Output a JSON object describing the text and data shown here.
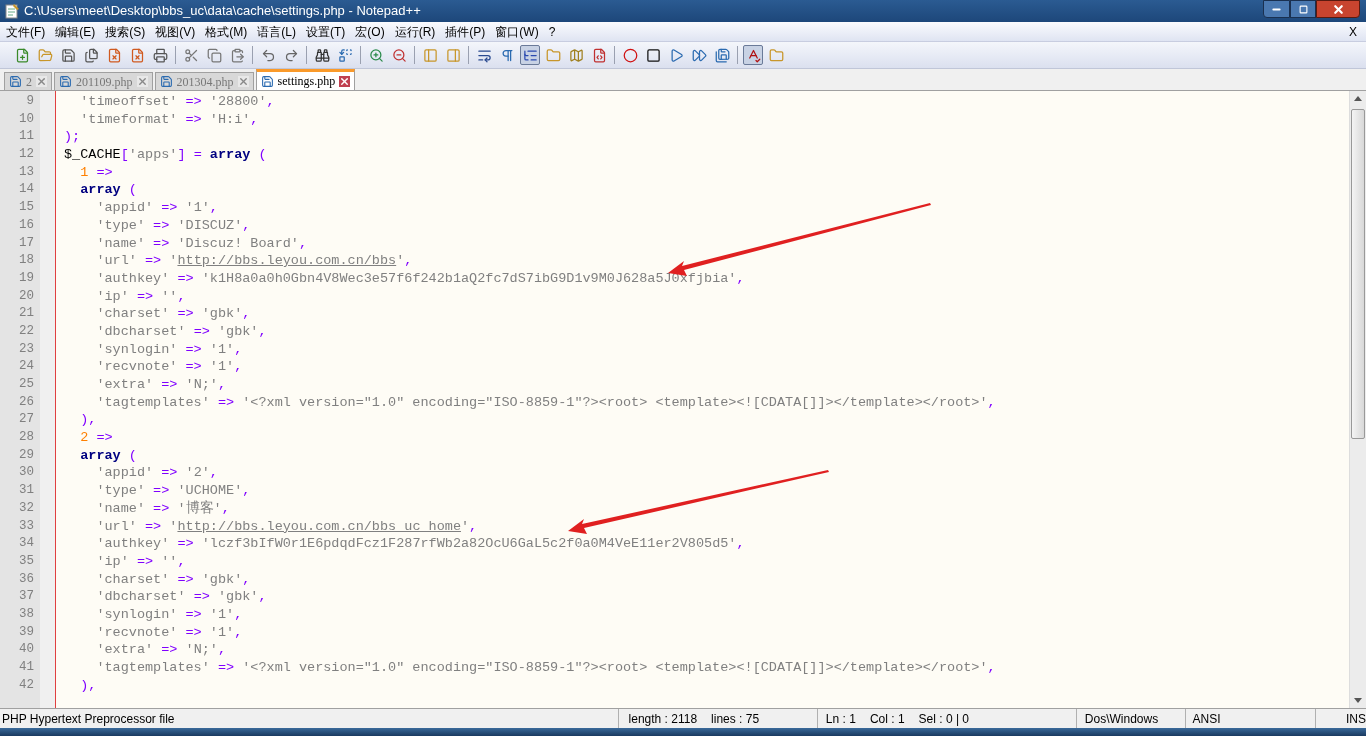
{
  "window": {
    "title": "C:\\Users\\meet\\Desktop\\bbs_uc\\data\\cache\\settings.php - Notepad++"
  },
  "menu": [
    "文件(F)",
    "编辑(E)",
    "搜索(S)",
    "视图(V)",
    "格式(M)",
    "语言(L)",
    "设置(T)",
    "宏(O)",
    "运行(R)",
    "插件(P)",
    "窗口(W)",
    "?"
  ],
  "menu_close": "X",
  "toolbar": [
    {
      "pressed": false
    },
    {
      "pressed": false
    },
    {
      "pressed": false
    },
    {
      "pressed": false
    },
    {
      "pressed": false
    },
    {
      "pressed": false
    },
    {
      "pressed": false
    },
    {
      "pressed": false
    },
    {
      "pressed": false
    },
    {
      "pressed": false
    },
    {
      "pressed": false
    },
    {
      "pressed": false
    },
    {
      "pressed": false
    },
    {
      "pressed": false
    },
    {
      "pressed": false
    },
    {
      "pressed": false
    },
    {
      "pressed": false
    },
    {
      "pressed": false
    },
    {
      "pressed": false
    },
    {
      "pressed": false
    },
    {
      "pressed": true
    },
    {
      "pressed": false
    },
    {
      "pressed": false
    },
    {
      "pressed": false
    },
    {
      "pressed": false
    },
    {
      "pressed": false
    },
    {
      "pressed": false
    },
    {
      "pressed": false
    },
    {
      "pressed": false
    },
    {
      "pressed": true
    },
    {
      "pressed": false
    }
  ],
  "tabs": [
    {
      "label": "2",
      "selected": false
    },
    {
      "label": "201109.php",
      "selected": false
    },
    {
      "label": "201304.php",
      "selected": false
    },
    {
      "label": "settings.php",
      "selected": true
    }
  ],
  "lines": [
    {
      "number": "9",
      "tokens": [
        {
          "kind": "string",
          "text": "  'timeoffset'"
        },
        {
          "kind": "operator",
          "text": " =>"
        },
        {
          "kind": "string",
          "text": " '28800'"
        },
        {
          "kind": "operator",
          "text": ","
        }
      ]
    },
    {
      "number": "10",
      "tokens": [
        {
          "kind": "string",
          "text": "  'timeformat'"
        },
        {
          "kind": "operator",
          "text": " =>"
        },
        {
          "kind": "string",
          "text": " 'H:i'"
        },
        {
          "kind": "operator",
          "text": ","
        }
      ]
    },
    {
      "number": "11",
      "tokens": [
        {
          "kind": "operator",
          "text": ");"
        }
      ]
    },
    {
      "number": "12",
      "tokens": [
        {
          "kind": "plain",
          "text": "$_CACHE"
        },
        {
          "kind": "operator",
          "text": "["
        },
        {
          "kind": "string",
          "text": "'apps'"
        },
        {
          "kind": "operator",
          "text": "] ="
        },
        {
          "kind": "keyword",
          "text": " array"
        },
        {
          "kind": "operator",
          "text": " ("
        }
      ]
    },
    {
      "number": "13",
      "tokens": [
        {
          "kind": "number",
          "text": "  1"
        },
        {
          "kind": "operator",
          "text": " =>"
        }
      ]
    },
    {
      "number": "14",
      "tokens": [
        {
          "kind": "keyword",
          "text": "  array"
        },
        {
          "kind": "operator",
          "text": " ("
        }
      ]
    },
    {
      "number": "15",
      "tokens": [
        {
          "kind": "string",
          "text": "    'appid'"
        },
        {
          "kind": "operator",
          "text": " =>"
        },
        {
          "kind": "string",
          "text": " '1'"
        },
        {
          "kind": "operator",
          "text": ","
        }
      ]
    },
    {
      "number": "16",
      "tokens": [
        {
          "kind": "string",
          "text": "    'type'"
        },
        {
          "kind": "operator",
          "text": " =>"
        },
        {
          "kind": "string",
          "text": " 'DISCUZ'"
        },
        {
          "kind": "operator",
          "text": ","
        }
      ]
    },
    {
      "number": "17",
      "tokens": [
        {
          "kind": "string",
          "text": "    'name'"
        },
        {
          "kind": "operator",
          "text": " =>"
        },
        {
          "kind": "string",
          "text": " 'Discuz! Board'"
        },
        {
          "kind": "operator",
          "text": ","
        }
      ]
    },
    {
      "number": "18",
      "tokens": [
        {
          "kind": "string",
          "text": "    'url'"
        },
        {
          "kind": "operator",
          "text": " =>"
        },
        {
          "kind": "string",
          "text": " '"
        },
        {
          "kind": "url",
          "text": "http://bbs.leyou.com.cn/bbs"
        },
        {
          "kind": "string",
          "text": "'"
        },
        {
          "kind": "operator",
          "text": ","
        }
      ]
    },
    {
      "number": "19",
      "tokens": [
        {
          "kind": "string",
          "text": "    'authkey'"
        },
        {
          "kind": "operator",
          "text": " =>"
        },
        {
          "kind": "string",
          "text": " 'k1H8a0a0h0Gbn4V8Wec3e57f6f242b1aQ2fc7dS7ibG9D1v9M0J628a5J0xfjbia'"
        },
        {
          "kind": "operator",
          "text": ","
        }
      ]
    },
    {
      "number": "20",
      "tokens": [
        {
          "kind": "string",
          "text": "    'ip'"
        },
        {
          "kind": "operator",
          "text": " =>"
        },
        {
          "kind": "string",
          "text": " ''"
        },
        {
          "kind": "operator",
          "text": ","
        }
      ]
    },
    {
      "number": "21",
      "tokens": [
        {
          "kind": "string",
          "text": "    'charset'"
        },
        {
          "kind": "operator",
          "text": " =>"
        },
        {
          "kind": "string",
          "text": " 'gbk'"
        },
        {
          "kind": "operator",
          "text": ","
        }
      ]
    },
    {
      "number": "22",
      "tokens": [
        {
          "kind": "string",
          "text": "    'dbcharset'"
        },
        {
          "kind": "operator",
          "text": " =>"
        },
        {
          "kind": "string",
          "text": " 'gbk'"
        },
        {
          "kind": "operator",
          "text": ","
        }
      ]
    },
    {
      "number": "23",
      "tokens": [
        {
          "kind": "string",
          "text": "    'synlogin'"
        },
        {
          "kind": "operator",
          "text": " =>"
        },
        {
          "kind": "string",
          "text": " '1'"
        },
        {
          "kind": "operator",
          "text": ","
        }
      ]
    },
    {
      "number": "24",
      "tokens": [
        {
          "kind": "string",
          "text": "    'recvnote'"
        },
        {
          "kind": "operator",
          "text": " =>"
        },
        {
          "kind": "string",
          "text": " '1'"
        },
        {
          "kind": "operator",
          "text": ","
        }
      ]
    },
    {
      "number": "25",
      "tokens": [
        {
          "kind": "string",
          "text": "    'extra'"
        },
        {
          "kind": "operator",
          "text": " =>"
        },
        {
          "kind": "string",
          "text": " 'N;'"
        },
        {
          "kind": "operator",
          "text": ","
        }
      ]
    },
    {
      "number": "26",
      "tokens": [
        {
          "kind": "string",
          "text": "    'tagtemplates'"
        },
        {
          "kind": "operator",
          "text": " =>"
        },
        {
          "kind": "string",
          "text": " '<?xml version=\"1.0\" encoding=\"ISO-8859-1\"?><root> <template><![CDATA[]]></template></root>'"
        },
        {
          "kind": "operator",
          "text": ","
        }
      ]
    },
    {
      "number": "27",
      "tokens": [
        {
          "kind": "operator",
          "text": "  ),"
        }
      ]
    },
    {
      "number": "28",
      "tokens": [
        {
          "kind": "number",
          "text": "  2"
        },
        {
          "kind": "operator",
          "text": " =>"
        }
      ]
    },
    {
      "number": "29",
      "tokens": [
        {
          "kind": "keyword",
          "text": "  array"
        },
        {
          "kind": "operator",
          "text": " ("
        }
      ]
    },
    {
      "number": "30",
      "tokens": [
        {
          "kind": "string",
          "text": "    'appid'"
        },
        {
          "kind": "operator",
          "text": " =>"
        },
        {
          "kind": "string",
          "text": " '2'"
        },
        {
          "kind": "operator",
          "text": ","
        }
      ]
    },
    {
      "number": "31",
      "tokens": [
        {
          "kind": "string",
          "text": "    'type'"
        },
        {
          "kind": "operator",
          "text": " =>"
        },
        {
          "kind": "string",
          "text": " 'UCHOME'"
        },
        {
          "kind": "operator",
          "text": ","
        }
      ]
    },
    {
      "number": "32",
      "tokens": [
        {
          "kind": "string",
          "text": "    'name'"
        },
        {
          "kind": "operator",
          "text": " =>"
        },
        {
          "kind": "string",
          "text": " '博客'"
        },
        {
          "kind": "operator",
          "text": ","
        }
      ]
    },
    {
      "number": "33",
      "tokens": [
        {
          "kind": "string",
          "text": "    'url'"
        },
        {
          "kind": "operator",
          "text": " =>"
        },
        {
          "kind": "string",
          "text": " '"
        },
        {
          "kind": "url",
          "text": "http://bbs.leyou.com.cn/bbs_uc_home"
        },
        {
          "kind": "string",
          "text": "'"
        },
        {
          "kind": "operator",
          "text": ","
        }
      ]
    },
    {
      "number": "34",
      "tokens": [
        {
          "kind": "string",
          "text": "    'authkey'"
        },
        {
          "kind": "operator",
          "text": " =>"
        },
        {
          "kind": "string",
          "text": " 'lczf3bIfW0r1E6pdqdFcz1F287rfWb2a82OcU6GaL5c2f0a0M4VeE11er2V805d5'"
        },
        {
          "kind": "operator",
          "text": ","
        }
      ]
    },
    {
      "number": "35",
      "tokens": [
        {
          "kind": "string",
          "text": "    'ip'"
        },
        {
          "kind": "operator",
          "text": " =>"
        },
        {
          "kind": "string",
          "text": " ''"
        },
        {
          "kind": "operator",
          "text": ","
        }
      ]
    },
    {
      "number": "36",
      "tokens": [
        {
          "kind": "string",
          "text": "    'charset'"
        },
        {
          "kind": "operator",
          "text": " =>"
        },
        {
          "kind": "string",
          "text": " 'gbk'"
        },
        {
          "kind": "operator",
          "text": ","
        }
      ]
    },
    {
      "number": "37",
      "tokens": [
        {
          "kind": "string",
          "text": "    'dbcharset'"
        },
        {
          "kind": "operator",
          "text": " =>"
        },
        {
          "kind": "string",
          "text": " 'gbk'"
        },
        {
          "kind": "operator",
          "text": ","
        }
      ]
    },
    {
      "number": "38",
      "tokens": [
        {
          "kind": "string",
          "text": "    'synlogin'"
        },
        {
          "kind": "operator",
          "text": " =>"
        },
        {
          "kind": "string",
          "text": " '1'"
        },
        {
          "kind": "operator",
          "text": ","
        }
      ]
    },
    {
      "number": "39",
      "tokens": [
        {
          "kind": "string",
          "text": "    'recvnote'"
        },
        {
          "kind": "operator",
          "text": " =>"
        },
        {
          "kind": "string",
          "text": " '1'"
        },
        {
          "kind": "operator",
          "text": ","
        }
      ]
    },
    {
      "number": "40",
      "tokens": [
        {
          "kind": "string",
          "text": "    'extra'"
        },
        {
          "kind": "operator",
          "text": " =>"
        },
        {
          "kind": "string",
          "text": " 'N;'"
        },
        {
          "kind": "operator",
          "text": ","
        }
      ]
    },
    {
      "number": "41",
      "tokens": [
        {
          "kind": "string",
          "text": "    'tagtemplates'"
        },
        {
          "kind": "operator",
          "text": " =>"
        },
        {
          "kind": "string",
          "text": " '<?xml version=\"1.0\" encoding=\"ISO-8859-1\"?><root> <template><![CDATA[]]></template></root>'"
        },
        {
          "kind": "operator",
          "text": ","
        }
      ]
    },
    {
      "number": "42",
      "tokens": [
        {
          "kind": "operator",
          "text": "  ),"
        }
      ]
    }
  ],
  "status_bar": {
    "file_type": "PHP Hypertext Preprocessor file",
    "length": "length : 2118",
    "lines": "lines : 75",
    "ln": "Ln : 1",
    "col": "Col : 1",
    "sel": "Sel : 0 | 0",
    "eol": "Dos\\Windows",
    "encoding": "ANSI",
    "mode": "INS"
  }
}
